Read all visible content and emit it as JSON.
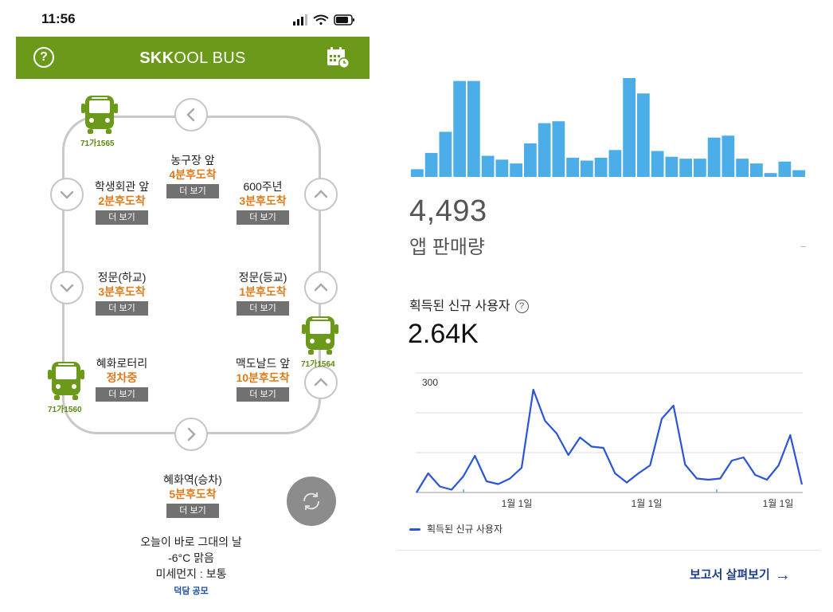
{
  "status_bar": {
    "time": "11:56"
  },
  "app": {
    "title_bold": "SKK",
    "title_rest": "OOL BUS",
    "help_symbol": "?",
    "accent_color": "#6b9a1a"
  },
  "stops": [
    {
      "name": "농구장 앞",
      "eta": "4분후도착",
      "more": "더 보기"
    },
    {
      "name": "학생회관 앞",
      "eta": "2분후도착",
      "more": "더 보기"
    },
    {
      "name": "600주년",
      "eta": "3분후도착",
      "more": "더 보기"
    },
    {
      "name": "정문(하교)",
      "eta": "3분후도착",
      "more": "더 보기"
    },
    {
      "name": "정문(등교)",
      "eta": "1분후도착",
      "more": "더 보기"
    },
    {
      "name": "혜화로터리",
      "eta": "정차중",
      "more": "더 보기"
    },
    {
      "name": "맥도날드 앞",
      "eta": "10분후도착",
      "more": "더 보기"
    },
    {
      "name": "혜화역(승차)",
      "eta": "5분후도착",
      "more": "더 보기"
    }
  ],
  "buses": [
    {
      "plate": "71가1565"
    },
    {
      "plate": "71가1564"
    },
    {
      "plate": "71가1560"
    }
  ],
  "weather": {
    "line1": "오늘이 바로 그대의 날",
    "line2": "-6°C 맑음",
    "line3": "미세먼지 : 보통"
  },
  "promo": "덕담 공모",
  "analytics": {
    "sales_value": "4,493",
    "sales_label": "앱 판매량",
    "users_title": "획득된 신규 사용자",
    "users_value": "2.64K",
    "legend": "획득된 신규 사용자",
    "report_link": "보고서 살펴보기",
    "series_color": "#2a55d6",
    "bar_color": "#4caee8"
  },
  "chart_data": [
    {
      "type": "bar",
      "values": [
        8,
        25,
        47,
        100,
        100,
        22,
        18,
        14,
        35,
        56,
        58,
        20,
        17,
        20,
        28,
        103,
        87,
        27,
        21,
        19,
        19,
        41,
        43,
        19,
        14,
        4,
        16,
        7
      ]
    },
    {
      "type": "line",
      "ylabel": "",
      "ylim": [
        0,
        300
      ],
      "ytick_labels": [
        "300"
      ],
      "x_tick_labels": [
        "1월 1일",
        "1월 1일",
        "1월 1일"
      ],
      "series": [
        {
          "name": "획득된 신규 사용자",
          "values": [
            0,
            48,
            15,
            7,
            40,
            92,
            28,
            21,
            35,
            62,
            258,
            180,
            148,
            94,
            138,
            115,
            112,
            48,
            25,
            48,
            68,
            185,
            218,
            70,
            35,
            32,
            35,
            80,
            88,
            44,
            32,
            68,
            144,
            20
          ]
        }
      ]
    }
  ]
}
